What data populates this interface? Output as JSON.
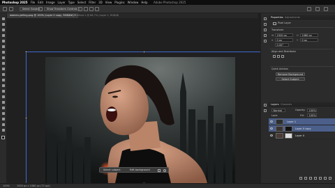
{
  "window": {
    "app_name": "Photoshop 2025",
    "title": "Adobe Photoshop 2025"
  },
  "menu": [
    "File",
    "Edit",
    "Image",
    "Layer",
    "Type",
    "Select",
    "Filter",
    "3D",
    "View",
    "Plugins",
    "Window",
    "Help"
  ],
  "options_bar": {
    "select_subject_label": "Select Subject",
    "show_transform_label": "Show Transform Controls"
  },
  "document_tabs": [
    {
      "label": "women-yelling.png @ 100% (Layer 0 copy, RGB/8#) *",
      "active": true
    },
    {
      "label": "Untitled-1 @ 66.7% (Layer 1, RGB/8)",
      "active": false
    }
  ],
  "context_bar": {
    "select_subject": "Select subject",
    "edit_background": "Edit background"
  },
  "status": {
    "zoom": "100%",
    "doc_info": "1920 px x 1080 px (72 ppi)"
  },
  "properties_panel": {
    "tabs": [
      "Properties",
      "Adjustments"
    ],
    "kind": "Pixel Layer",
    "transform_label": "Transform",
    "w_value": "1920 px",
    "h_value": "1080 px",
    "x_value": "0 px",
    "y_value": "0 px",
    "angle_value": "0.00°",
    "align_label": "Align and Distribute",
    "quick_actions_label": "Quick Actions",
    "remove_background": "Remove Background",
    "select_subject": "Select Subject"
  },
  "layers_panel": {
    "tabs": [
      "Layers",
      "Channels"
    ],
    "blend_mode": "Normal",
    "opacity_label": "Opacity:",
    "opacity_value": "100%",
    "fill_label": "Fill:",
    "fill_value": "100%",
    "lock_label": "Lock:",
    "layers": [
      {
        "name": "Layer 1",
        "selected": true
      },
      {
        "name": "Layer 0 copy",
        "selected": true
      },
      {
        "name": "Layer 0",
        "selected": false
      }
    ]
  },
  "colors": {
    "accent": "#3f6ad0",
    "selected_layer": "#4b5f8a",
    "panel_bg": "#2b2b2b"
  }
}
